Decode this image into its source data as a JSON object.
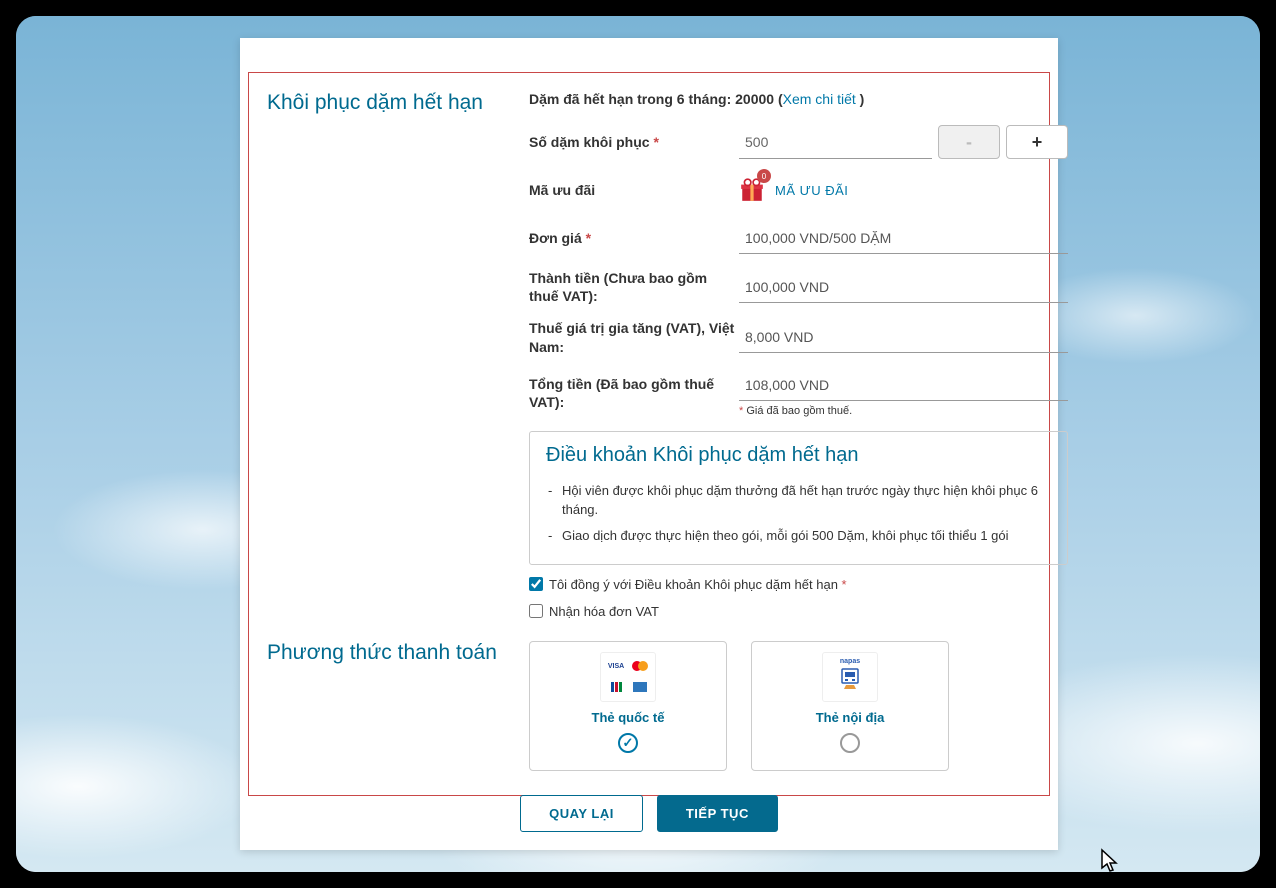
{
  "section_title": "Khôi phục dặm hết hạn",
  "header": {
    "prefix": "Dặm đã hết hạn trong 6 tháng: ",
    "amount": "20000",
    "detail_open": " (",
    "detail_link": "Xem chi tiết",
    "detail_close": " )"
  },
  "fields": {
    "quantity_label": "Số dặm khôi phục ",
    "quantity_value": "500",
    "promo_label": "Mã ưu đãi",
    "promo_link": "MÃ ƯU ĐÃI",
    "promo_badge": "0",
    "unit_price_label": "Đơn giá ",
    "unit_price_value": "100,000 VND/500 DẶM",
    "subtotal_label": "Thành tiền (Chưa bao gồm thuế VAT):",
    "subtotal_value": "100,000 VND",
    "vat_label": "Thuế giá trị gia tăng (VAT), Việt Nam:",
    "vat_value": "8,000 VND",
    "total_label": "Tổng tiền (Đã bao gồm thuế VAT):",
    "total_value": "108,000 VND",
    "price_note": " Giá đã bao gồm thuế."
  },
  "terms": {
    "title": "Điều khoản Khôi phục dặm hết hạn",
    "item1": "Hội viên được khôi phục dặm thưởng đã hết hạn trước ngày thực hiện khôi phục 6 tháng.",
    "item2": "Giao dịch được thực hiện theo gói, mỗi gói 500 Dặm, khôi phục tối thiểu 1 gói"
  },
  "checkboxes": {
    "agree_label": "Tôi đồng ý với Điều khoản Khôi phục dặm hết hạn ",
    "vat_invoice_label": "Nhận hóa đơn VAT"
  },
  "payment": {
    "section_title": "Phương thức thanh toán",
    "international_label": "Thẻ quốc tế",
    "domestic_label": "Thẻ nội địa",
    "napas_text": "napas"
  },
  "buttons": {
    "back": "QUAY LẠI",
    "continue": "TIẾP TỤC",
    "minus": "-",
    "plus": "+"
  },
  "required_marker": "*"
}
